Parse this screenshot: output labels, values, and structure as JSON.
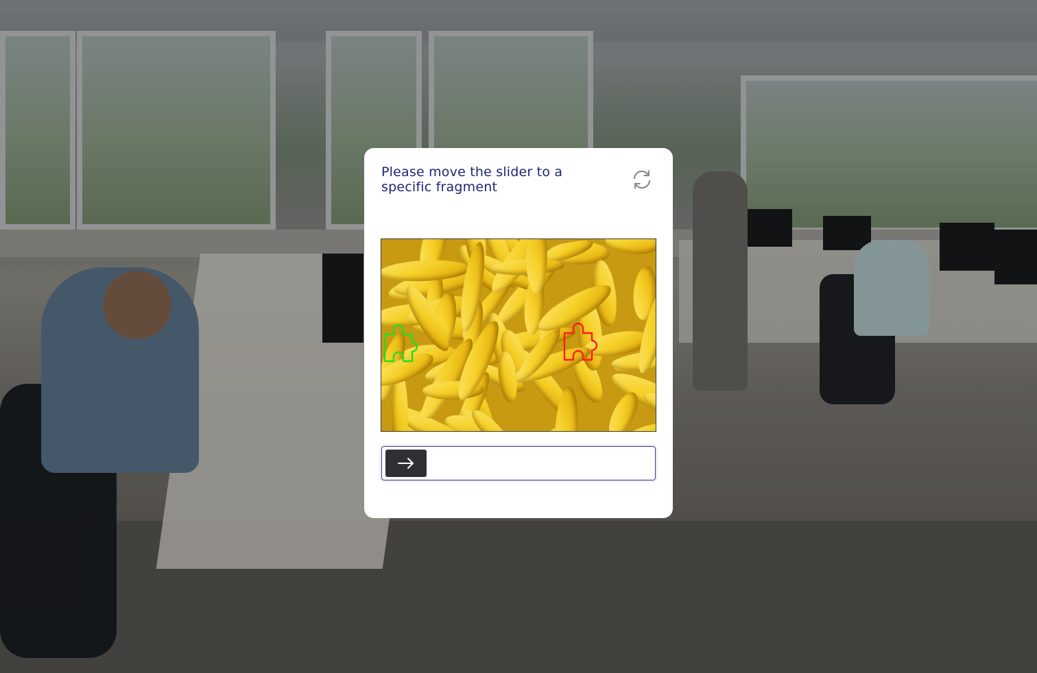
{
  "captcha": {
    "title": "Please move the slider to a specific fragment",
    "refresh_icon": "refresh-icon",
    "image_subject": "bananas",
    "slider_icon": "arrow-right-icon",
    "target_piece_color": "#ff1a1a",
    "draggable_piece_color": "#22dd22",
    "slider_progress": 0
  },
  "colors": {
    "title": "#1d2474",
    "slider_handle": "#2f3033",
    "slider_border": "#3b3f9a"
  }
}
